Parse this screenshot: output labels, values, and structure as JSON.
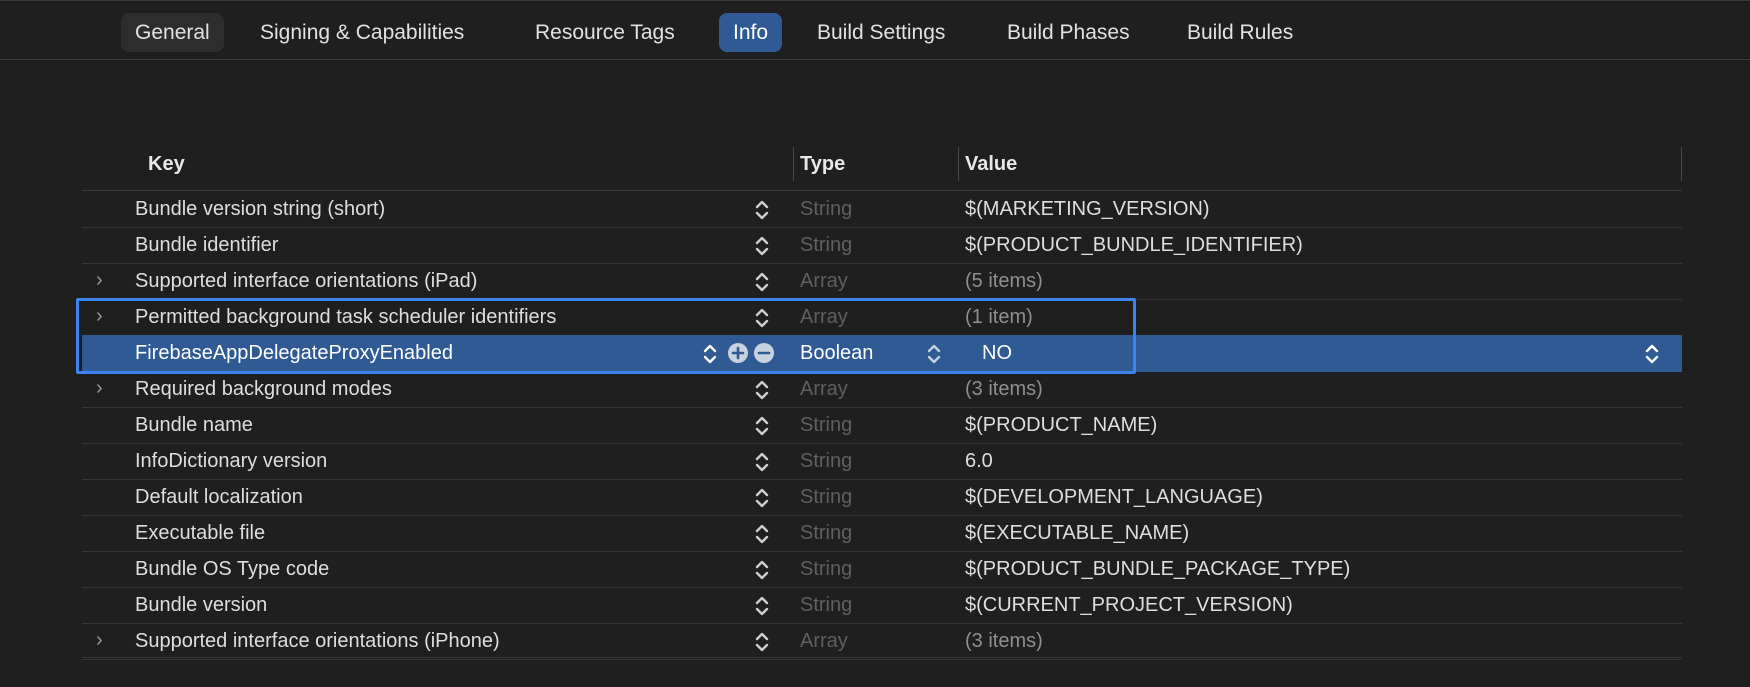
{
  "tabs": [
    {
      "label": "General"
    },
    {
      "label": "Signing & Capabilities"
    },
    {
      "label": "Resource Tags"
    },
    {
      "label": "Info"
    },
    {
      "label": "Build Settings"
    },
    {
      "label": "Build Phases"
    },
    {
      "label": "Build Rules"
    }
  ],
  "active_tab": "Info",
  "table": {
    "headers": {
      "key": "Key",
      "type": "Type",
      "value": "Value"
    },
    "rows": [
      {
        "key": "Bundle version string (short)",
        "type": "String",
        "value": "$(MARKETING_VERSION)",
        "expandable": false
      },
      {
        "key": "Bundle identifier",
        "type": "String",
        "value": "$(PRODUCT_BUNDLE_IDENTIFIER)",
        "expandable": false
      },
      {
        "key": "Supported interface orientations (iPad)",
        "type": "Array",
        "value": "(5 items)",
        "expandable": true
      },
      {
        "key": "Permitted background task scheduler identifiers",
        "type": "Array",
        "value": "(1 item)",
        "expandable": true
      },
      {
        "key": "FirebaseAppDelegateProxyEnabled",
        "type": "Boolean",
        "value": "NO",
        "expandable": false,
        "selected": true
      },
      {
        "key": "Required background modes",
        "type": "Array",
        "value": "(3 items)",
        "expandable": true
      },
      {
        "key": "Bundle name",
        "type": "String",
        "value": "$(PRODUCT_NAME)",
        "expandable": false
      },
      {
        "key": "InfoDictionary version",
        "type": "String",
        "value": "6.0",
        "expandable": false
      },
      {
        "key": "Default localization",
        "type": "String",
        "value": "$(DEVELOPMENT_LANGUAGE)",
        "expandable": false
      },
      {
        "key": "Executable file",
        "type": "String",
        "value": "$(EXECUTABLE_NAME)",
        "expandable": false
      },
      {
        "key": "Bundle OS Type code",
        "type": "String",
        "value": "$(PRODUCT_BUNDLE_PACKAGE_TYPE)",
        "expandable": false
      },
      {
        "key": "Bundle version",
        "type": "String",
        "value": "$(CURRENT_PROJECT_VERSION)",
        "expandable": false
      },
      {
        "key": "Supported interface orientations (iPhone)",
        "type": "Array",
        "value": "(3 items)",
        "expandable": true
      }
    ]
  },
  "icons": {
    "disclosure": "chevron-right-icon",
    "stepper": "up-down-stepper-icon",
    "add": "plus-circle-icon",
    "remove": "minus-circle-icon"
  },
  "colors": {
    "selection": "#2f5a94",
    "highlight_box": "#3c83f0",
    "background": "#1f1f1f"
  }
}
